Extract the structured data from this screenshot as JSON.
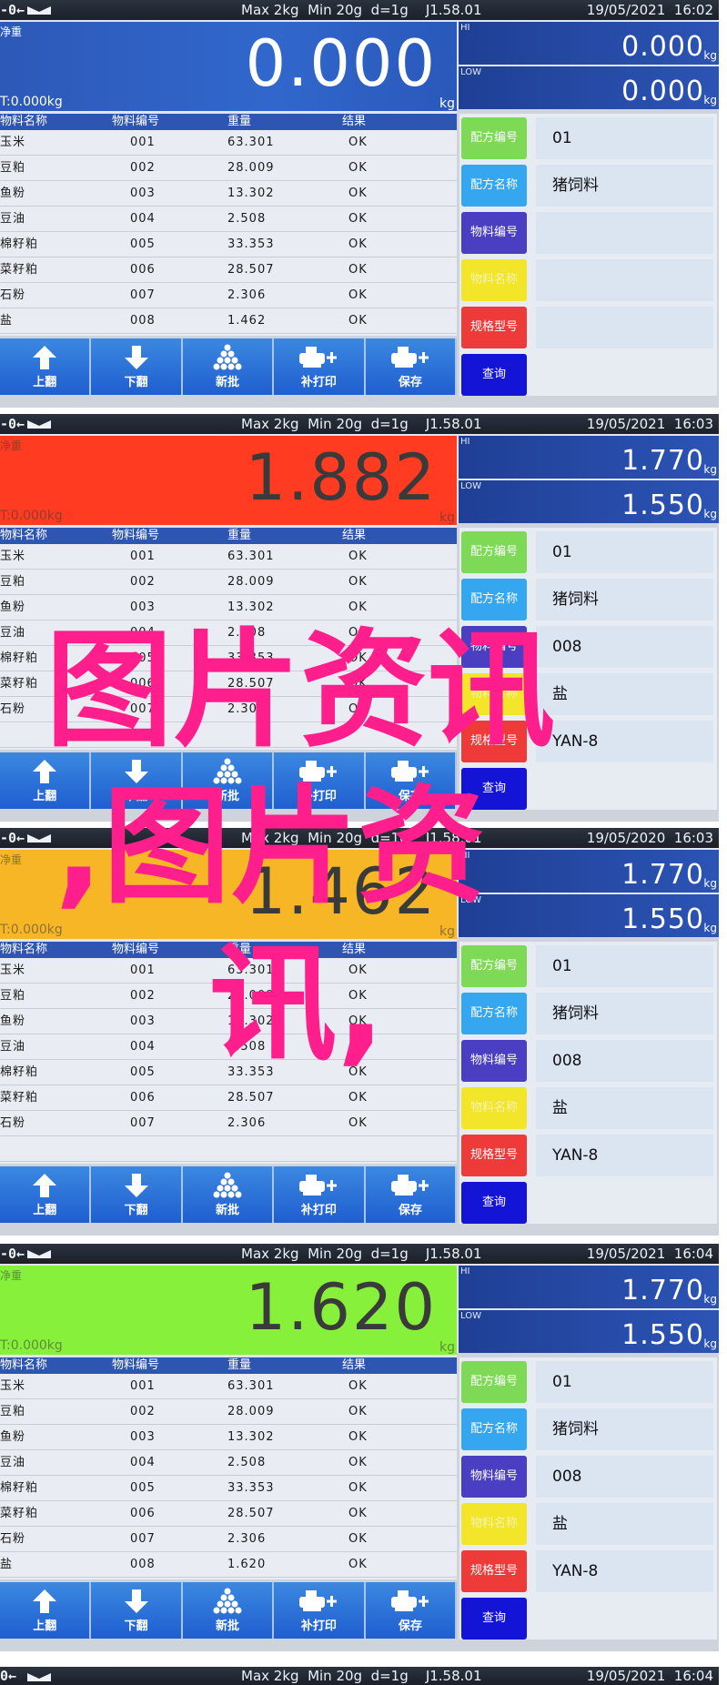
{
  "colors": {
    "status_bar": "#1f2530",
    "blue_display": "#3167cc",
    "red_display": "#ff3b22",
    "yellow_display": "#f6b625",
    "green_display": "#86f03a",
    "watermark": "#ff1f8c",
    "side_green": "#7ed957",
    "side_cyan": "#35a6f0",
    "side_purple": "#4a3fc2",
    "side_yellow": "#f2e52a",
    "side_red": "#ef3a3a",
    "side_blue": "#1414d6"
  },
  "common": {
    "spec": "Max 2kg  Min 20g  d=1g    J1.58.01",
    "net_label": "净重",
    "tare": "T:0.000kg",
    "unit": "kg",
    "hi_label": "HI",
    "low_label": "LOW",
    "table_headers": [
      "物料名称",
      "物料编号",
      "重量",
      "结果"
    ],
    "toolbar": [
      "上翻",
      "下翻",
      "新批",
      "补打印",
      "保存"
    ],
    "side_buttons": [
      "配方编号",
      "配方名称",
      "物料编号",
      "物料名称",
      "规格型号",
      "查询"
    ]
  },
  "panels": [
    {
      "datetime": "19/05/2021  16:02",
      "weight": "0.000",
      "hi": "0.000",
      "low": "0.000",
      "rows": [
        [
          "玉米",
          "001",
          "63.301",
          "OK"
        ],
        [
          "豆粕",
          "002",
          "28.009",
          "OK"
        ],
        [
          "鱼粉",
          "003",
          "13.302",
          "OK"
        ],
        [
          "豆油",
          "004",
          "2.508",
          "OK"
        ],
        [
          "棉籽粕",
          "005",
          "33.353",
          "OK"
        ],
        [
          "菜籽粕",
          "006",
          "28.507",
          "OK"
        ],
        [
          "石粉",
          "007",
          "2.306",
          "OK"
        ],
        [
          "盐",
          "008",
          "1.462",
          "OK"
        ]
      ],
      "fields": [
        "01",
        "猪饲料",
        "",
        "",
        "",
        ""
      ]
    },
    {
      "datetime": "19/05/2021  16:03",
      "weight": "1.882",
      "hi": "1.770",
      "low": "1.550",
      "rows": [
        [
          "玉米",
          "001",
          "63.301",
          "OK"
        ],
        [
          "豆粕",
          "002",
          "28.009",
          "OK"
        ],
        [
          "鱼粉",
          "003",
          "13.302",
          "OK"
        ],
        [
          "豆油",
          "004",
          "2.508",
          "OK"
        ],
        [
          "棉籽粕",
          "005",
          "33.353",
          "OK"
        ],
        [
          "菜籽粕",
          "006",
          "28.507",
          "OK"
        ],
        [
          "石粉",
          "007",
          "2.306",
          "OK"
        ]
      ],
      "fields": [
        "01",
        "猪饲料",
        "008",
        "盐",
        "YAN-8",
        ""
      ]
    },
    {
      "datetime": "19/05/2020  16:03",
      "weight": "1.462",
      "hi": "1.770",
      "low": "1.550",
      "rows": [
        [
          "玉米",
          "001",
          "63.301",
          "OK"
        ],
        [
          "豆粕",
          "002",
          "28.009",
          "OK"
        ],
        [
          "鱼粉",
          "003",
          "13.302",
          "OK"
        ],
        [
          "豆油",
          "004",
          "2.508",
          "OK"
        ],
        [
          "棉籽粕",
          "005",
          "33.353",
          "OK"
        ],
        [
          "菜籽粕",
          "006",
          "28.507",
          "OK"
        ],
        [
          "石粉",
          "007",
          "2.306",
          "OK"
        ]
      ],
      "fields": [
        "01",
        "猪饲料",
        "008",
        "盐",
        "YAN-8",
        ""
      ]
    },
    {
      "datetime": "19/05/2021  16:04",
      "weight": "1.620",
      "hi": "1.770",
      "low": "1.550",
      "rows": [
        [
          "玉米",
          "001",
          "63.301",
          "OK"
        ],
        [
          "豆粕",
          "002",
          "28.009",
          "OK"
        ],
        [
          "鱼粉",
          "003",
          "13.302",
          "OK"
        ],
        [
          "豆油",
          "004",
          "2.508",
          "OK"
        ],
        [
          "棉籽粕",
          "005",
          "33.353",
          "OK"
        ],
        [
          "菜籽粕",
          "006",
          "28.507",
          "OK"
        ],
        [
          "石粉",
          "007",
          "2.306",
          "OK"
        ],
        [
          "盐",
          "008",
          "1.620",
          "OK"
        ]
      ],
      "fields": [
        "01",
        "猪饲料",
        "008",
        "盐",
        "YAN-8",
        ""
      ]
    }
  ],
  "bottom_strip": {
    "spec": "Max 2kg  Min 20g  d=1g    J1.58.01",
    "datetime": "19/05/2021  16:04"
  },
  "watermark": {
    "line1": "图片资讯",
    "line2": ",图片资",
    "line3": "讯,"
  }
}
